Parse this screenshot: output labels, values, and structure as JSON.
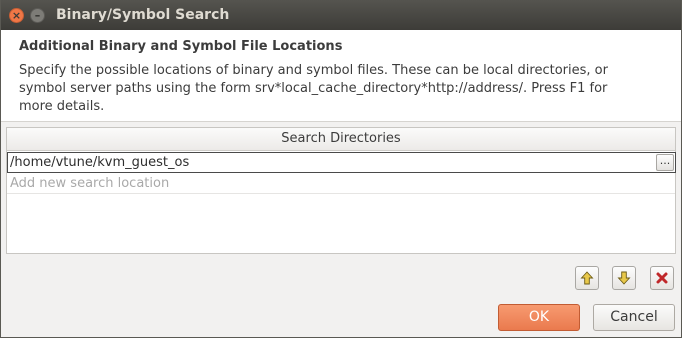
{
  "window": {
    "title": "Binary/Symbol Search",
    "close_glyph": "×",
    "minimize_glyph": "–"
  },
  "header": {
    "title": "Additional Binary and Symbol File Locations",
    "description_lines": [
      "Specify the possible locations of binary and symbol files. These can be local directories, or",
      "symbol server paths using the form srv*local_cache_directory*http://address/. Press F1 for",
      "more details."
    ]
  },
  "table": {
    "column_header": "Search Directories",
    "rows": [
      {
        "value": "/home/vtune/kvm_guest_os",
        "browse_label": "..."
      }
    ],
    "new_row_placeholder": "Add new search location"
  },
  "toolbar": {
    "move_up_icon": "arrow-up-icon",
    "move_down_icon": "arrow-down-icon",
    "remove_icon": "remove-icon",
    "arrow_color": "#e8c84a",
    "remove_color": "#c0282a"
  },
  "buttons": {
    "ok_label": "OK",
    "cancel_label": "Cancel"
  }
}
